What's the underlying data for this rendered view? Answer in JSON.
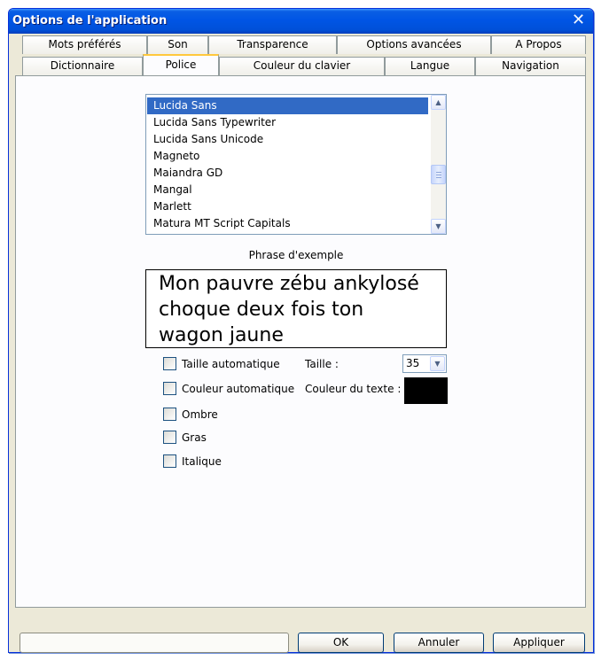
{
  "window": {
    "title": "Options de l'application",
    "close_glyph": "✕"
  },
  "tabs_row1": [
    {
      "label": "Mots préférés"
    },
    {
      "label": "Son"
    },
    {
      "label": "Transparence"
    },
    {
      "label": "Options avancées"
    },
    {
      "label": "A Propos"
    }
  ],
  "tabs_row2": [
    {
      "label": "Dictionnaire"
    },
    {
      "label": "Police",
      "active": true
    },
    {
      "label": "Couleur du clavier"
    },
    {
      "label": "Langue"
    },
    {
      "label": "Navigation"
    }
  ],
  "font_list": {
    "selected": "Lucida Sans",
    "items": [
      "Lucida Sans",
      "Lucida Sans Typewriter",
      "Lucida Sans Unicode",
      "Magneto",
      "Maiandra GD",
      "Mangal",
      "Marlett",
      "Matura MT Script Capitals"
    ],
    "scroll_up_icon": "scroll-up-arrow",
    "scroll_down_icon": "scroll-down-arrow"
  },
  "sample": {
    "label": "Phrase d'exemple",
    "line1": "Mon pauvre zébu ankylosé",
    "line2": "choque deux fois ton",
    "line3": "wagon jaune"
  },
  "options": {
    "auto_size": "Taille automatique",
    "auto_color": "Couleur automatique",
    "shadow": "Ombre",
    "bold": "Gras",
    "italic": "Italique"
  },
  "size": {
    "label": "Taille :",
    "value": "35"
  },
  "text_color": {
    "label": "Couleur du texte :",
    "color": "#000000"
  },
  "buttons": {
    "ok": "OK",
    "cancel": "Annuler",
    "apply": "Appliquer"
  },
  "colors": {
    "titlebar": "#0055e5",
    "selection": "#316ac5",
    "active_tab_accent": "#ffc83c",
    "dialog_bg": "#ece9d8"
  }
}
